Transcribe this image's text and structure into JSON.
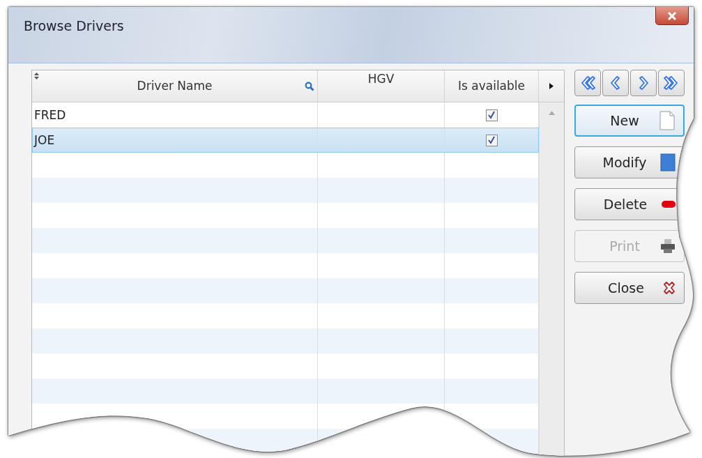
{
  "window": {
    "title": "Browse Drivers"
  },
  "table": {
    "columns": [
      {
        "label": "Driver Name",
        "searchable": true
      },
      {
        "label": "HGV",
        "searchable": false
      },
      {
        "label": "Is available",
        "searchable": false
      }
    ],
    "rows": [
      {
        "name": "FRED",
        "available": true,
        "selected": false
      },
      {
        "name": "JOE",
        "available": true,
        "selected": true
      }
    ]
  },
  "nav_buttons": [
    {
      "kind": "first"
    },
    {
      "kind": "prev"
    },
    {
      "kind": "next"
    },
    {
      "kind": "last"
    }
  ],
  "buttons": [
    {
      "label": "New",
      "kind": "new",
      "focused": true,
      "disabled": false
    },
    {
      "label": "Modify",
      "kind": "modify",
      "focused": false,
      "disabled": false
    },
    {
      "label": "Delete",
      "kind": "delete",
      "focused": false,
      "disabled": false
    },
    {
      "label": "Print",
      "kind": "print",
      "focused": false,
      "disabled": true
    },
    {
      "label": "Close",
      "kind": "close",
      "focused": false,
      "disabled": false
    }
  ]
}
